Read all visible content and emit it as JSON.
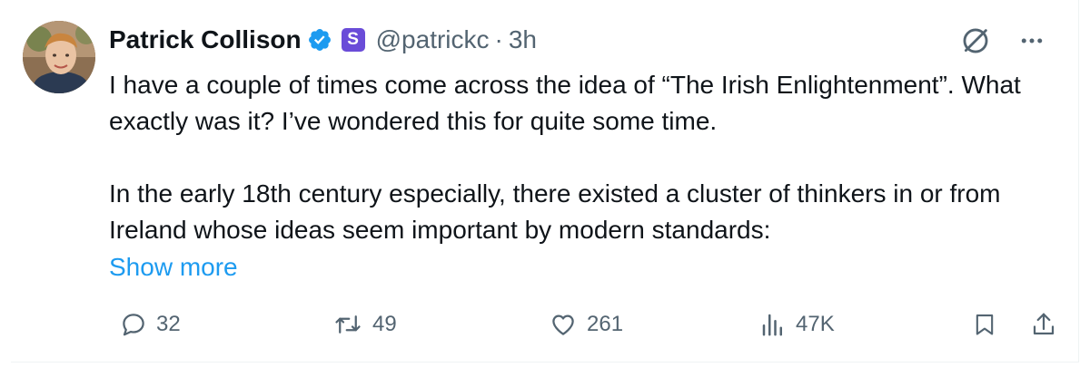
{
  "author": {
    "name": "Patrick Collison",
    "handle": "@patrickc",
    "separator": "·",
    "time": "3h",
    "subscription_badge": "S",
    "verified_color": "#1d9bf0"
  },
  "tweet": {
    "paragraphs": [
      "I have a couple of times come across the idea of “The Irish Enlightenment”. What exactly was it? I’ve wondered this for quite some time.",
      "In the early 18th century especially, there existed a cluster of thinkers in or from Ireland whose ideas seem important by modern standards:"
    ],
    "show_more": "Show more"
  },
  "actions": {
    "replies": "32",
    "reposts": "49",
    "likes": "261",
    "views": "47K"
  },
  "icons": {
    "top_right": [
      "grok-icon",
      "more-icon"
    ],
    "bottom": [
      "reply-icon",
      "repost-icon",
      "like-icon",
      "views-icon",
      "bookmark-icon",
      "share-icon"
    ]
  },
  "colors": {
    "text": "#0f1419",
    "muted": "#536471",
    "link": "#1d9bf0",
    "subscription": "#6a4cd8"
  }
}
